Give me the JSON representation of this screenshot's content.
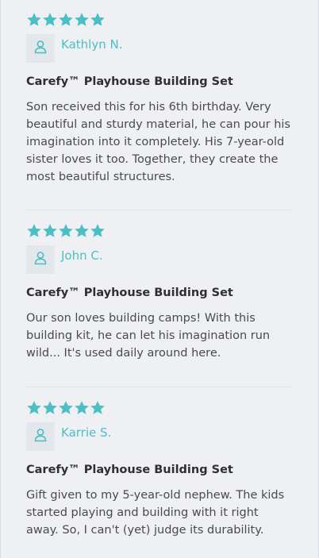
{
  "colors": {
    "accent": "#4bbfc4",
    "star": "#4bbfc4",
    "background": "#eef0f4"
  },
  "icons": {
    "star": "star-icon",
    "avatar": "user-icon"
  },
  "reviews": [
    {
      "rating": 5,
      "reviewer": "Kathlyn N.",
      "product": "Carefy™ Playhouse Building Set",
      "text": "Son received this for his 6th birthday. Very beautiful and sturdy material, he can pour his imagination into it completely. His 7-year-old sister loves it too. Together, they create the most beautiful structures."
    },
    {
      "rating": 5,
      "reviewer": "John C.",
      "product": "Carefy™ Playhouse Building Set",
      "text": "Our son loves building camps! With this building kit, he can let his imagination run wild... It's used daily around here."
    },
    {
      "rating": 5,
      "reviewer": "Karrie S.",
      "product": "Carefy™ Playhouse Building Set",
      "text": "Gift given to my 5-year-old nephew. The kids started playing and building with it right away. So, I can't (yet) judge its durability."
    }
  ]
}
